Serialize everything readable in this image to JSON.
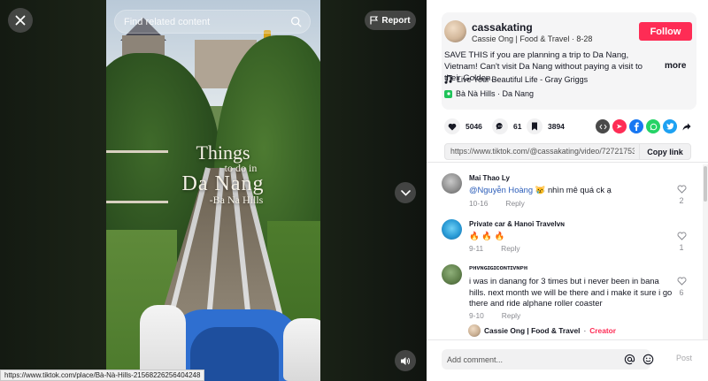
{
  "video": {
    "search_placeholder": "Find related content",
    "report_label": "Report",
    "overlay_line1": "Things",
    "overlay_line2": "to do in",
    "overlay_line3": "Da Nang",
    "overlay_line4": "-Ba Na Hills",
    "status_url": "https://www.tiktok.com/place/Bà-Nà-Hills-21568226256404248"
  },
  "author": {
    "username": "cassakating",
    "display_name": "Cassie Ong | Food & Travel",
    "separator": " · ",
    "date": "8-28",
    "follow_label": "Follow"
  },
  "post": {
    "description": "SAVE THIS if you are planning a trip to Da Nang, Vietnam! Can't visit Da Nang without paying a visit to their Golden…",
    "more_label": "more",
    "music": "Live Your Beautiful Life - Gray Griggs",
    "place": "Bà Nà Hills · Da Nang"
  },
  "stats": {
    "likes": "5046",
    "comments": "61",
    "saves": "3894"
  },
  "share": {
    "url": "https://www.tiktok.com/@cassakating/video/72721753...",
    "copy_label": "Copy link",
    "icons": [
      "embed-icon",
      "pinterest-icon",
      "facebook-icon",
      "whatsapp-icon",
      "twitter-icon",
      "share-forward-icon"
    ],
    "colors": {
      "embed": "#4a4a4a",
      "pinterest": "#fe2c55",
      "facebook": "#1877f2",
      "whatsapp": "#25d366",
      "twitter": "#1da1f2"
    }
  },
  "comments": [
    {
      "user": "Mai Thao Ly",
      "mention": "@Nguyễn Hoàng",
      "text": " 😿 nhìn mê quá ck ạ",
      "date": "10-16",
      "reply_label": "Reply",
      "likes": "2"
    },
    {
      "user": "Private car & Hanoi Travelᴠɴ",
      "mention": "",
      "text": "🔥 🔥 🔥",
      "date": "9-11",
      "reply_label": "Reply",
      "likes": "1"
    },
    {
      "user": "ᴘʜᴠɴɢɪɢɪᴄᴏɴᴛɪᴠɴᴘʜ",
      "mention": "",
      "text": "i was in danang for 3 times but i never been in bana hills. next month we will be there and i make it sure i go there and ride alphane roller coaster",
      "date": "9-10",
      "reply_label": "Reply",
      "likes": "6"
    }
  ],
  "creator_reply": {
    "name": "Cassie Ong | Food & Travel",
    "separator": " · ",
    "tag": "Creator"
  },
  "comment_bar": {
    "placeholder": "Add comment...",
    "post_label": "Post"
  },
  "colors": {
    "accent": "#fe2c55",
    "mention": "#2b5db9"
  }
}
